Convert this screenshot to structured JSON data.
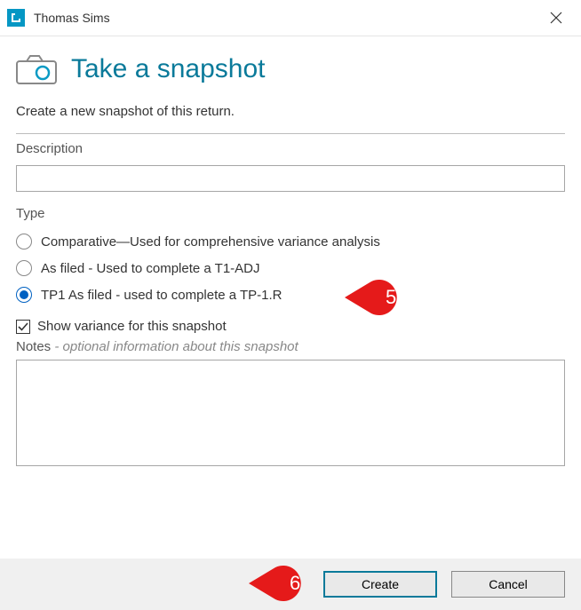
{
  "titlebar": {
    "title": "Thomas Sims"
  },
  "header": {
    "heading": "Take a snapshot"
  },
  "subtext": "Create a new snapshot of this return.",
  "description": {
    "label": "Description",
    "value": ""
  },
  "type": {
    "label": "Type",
    "options": [
      {
        "label": "Comparative—Used for comprehensive variance analysis",
        "selected": false
      },
      {
        "label": "As filed - Used to complete a T1-ADJ",
        "selected": false
      },
      {
        "label": "TP1 As filed - used to complete a TP-1.R",
        "selected": true
      }
    ]
  },
  "show_variance": {
    "label": "Show variance for this snapshot",
    "checked": true
  },
  "notes": {
    "label": "Notes",
    "hint": " - optional information about this snapshot",
    "value": ""
  },
  "footer": {
    "create": "Create",
    "cancel": "Cancel"
  },
  "callouts": {
    "five": "5",
    "six": "6"
  }
}
